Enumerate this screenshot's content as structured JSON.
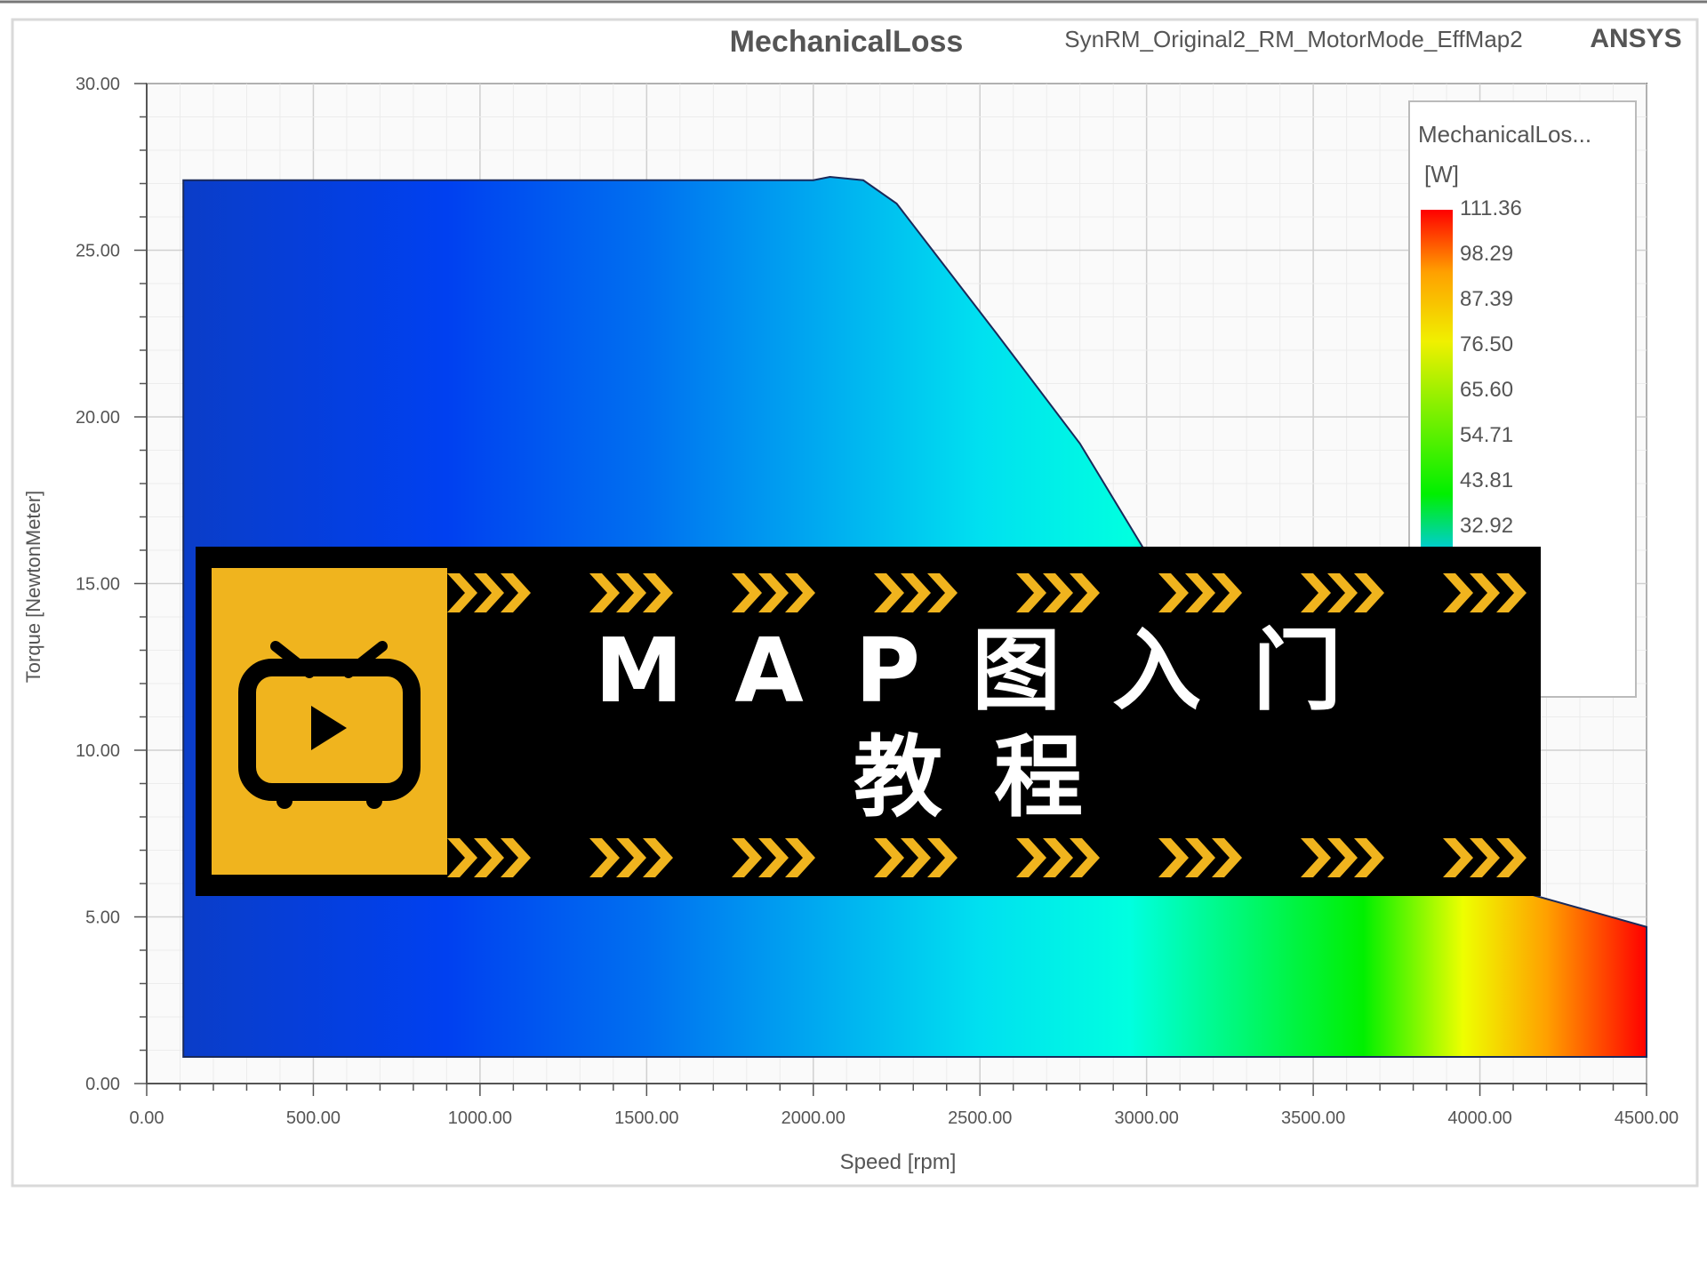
{
  "chart_data": {
    "type": "heatmap",
    "title": "MechanicalLoss",
    "subtitle": "SynRM_Original2_RM_MotorMode_EffMap2",
    "brand": "ANSYS",
    "xlabel": "Speed [rpm]",
    "ylabel": "Torque [NewtonMeter]",
    "xlim": [
      0,
      4500
    ],
    "ylim": [
      0,
      30
    ],
    "x_ticks": [
      "0.00",
      "500.00",
      "1000.00",
      "1500.00",
      "2000.00",
      "2500.00",
      "3000.00",
      "3500.00",
      "4000.00",
      "4500.00"
    ],
    "y_ticks": [
      "0.00",
      "5.00",
      "10.00",
      "15.00",
      "20.00",
      "25.00",
      "30.00"
    ],
    "grid": true,
    "legend": {
      "title": "MechanicalLos...",
      "unit": "[W]",
      "placement": "top-right",
      "values": [
        "111.36",
        "98.29",
        "87.39",
        "76.50",
        "65.60",
        "54.71",
        "43.81",
        "32.92"
      ]
    },
    "envelope": {
      "speed": [
        110,
        2000,
        2050,
        2150,
        2250,
        2550,
        2800,
        3000,
        3150,
        3400,
        4000,
        4500
      ],
      "torque": [
        27.1,
        27.1,
        27.2,
        27.1,
        26.4,
        22.5,
        19.2,
        15.9,
        13.2,
        9.0,
        6.1,
        4.7
      ],
      "min_torque": 0.8
    },
    "colormap": {
      "speed_stops": [
        110,
        900,
        1500,
        2500,
        2950,
        3650,
        3950,
        4200,
        4500
      ],
      "colors": [
        "#0A3DC8",
        "#0040F0",
        "#0070F0",
        "#00E0F0",
        "#00FFE0",
        "#00F000",
        "#EEFF00",
        "#FFA000",
        "#FF0000"
      ]
    },
    "colors": {
      "accent_yellow": "#F0B41E",
      "banner_bg": "#000000"
    }
  },
  "banner": {
    "line1": "MAP图入门",
    "line2": "教程",
    "icon": "tv-play-icon"
  }
}
